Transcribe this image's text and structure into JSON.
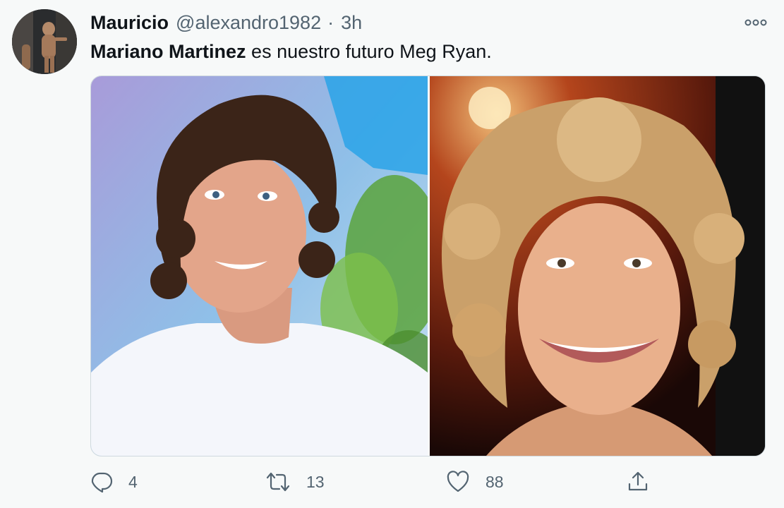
{
  "tweet": {
    "author": {
      "display_name": "Mauricio",
      "handle": "@alexandro1982",
      "separator": "·",
      "time": "3h",
      "avatar_icon": "avatar-photo"
    },
    "text": {
      "mention": "Mariano Martinez",
      "body": " es nuestro futuro Meg Ryan."
    },
    "media": {
      "photos": [
        {
          "icon": "photo-man-curly-hair"
        },
        {
          "icon": "photo-woman-blonde-curls"
        }
      ]
    },
    "actions": {
      "reply": {
        "icon": "reply-icon",
        "count": "4"
      },
      "retweet": {
        "icon": "retweet-icon",
        "count": "13"
      },
      "like": {
        "icon": "heart-icon",
        "count": "88"
      },
      "share": {
        "icon": "share-icon"
      }
    },
    "more_icon": "ellipsis-icon"
  },
  "colors": {
    "background": "#f7f9f9",
    "text_primary": "#0f1419",
    "text_secondary": "#536471",
    "border": "#cfd9de"
  }
}
